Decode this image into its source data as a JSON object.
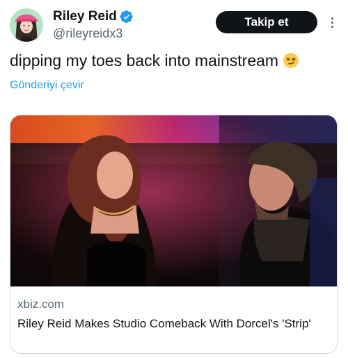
{
  "author": {
    "display_name": "Riley Reid",
    "handle": "@rileyreidx3",
    "avatar_icon": "avatar-illustration",
    "verified_icon": "verified-badge-icon",
    "verified_color": "#1d9bf0"
  },
  "actions": {
    "follow_label": "Takip et",
    "more_icon": "more-options-icon"
  },
  "tweet": {
    "text": "dipping my toes back into mainstream",
    "emoji_icon": "smirking-face-emoji",
    "translate_label": "Gönderiyi çevir"
  },
  "link_card": {
    "domain": "xbiz.com",
    "title": "Riley Reid Makes Studio Comeback With Dorcel's 'Strip'",
    "image_icon": "article-photo"
  },
  "colors": {
    "accent": "#1d9bf0",
    "text_primary": "#0f1419",
    "text_secondary": "#536471",
    "follow_bg": "#0f1419",
    "border": "#cfd9de"
  }
}
